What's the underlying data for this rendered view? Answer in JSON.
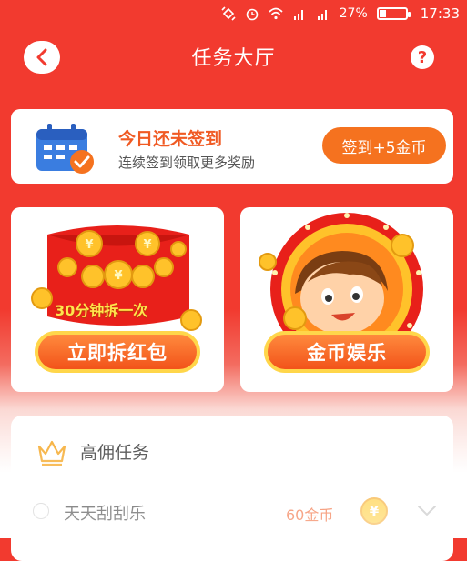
{
  "status_bar": {
    "battery": "27%",
    "time": "17:33",
    "icons": [
      "rotate-icon",
      "alarm-icon",
      "wifi-icon",
      "signal-icon",
      "signal-icon",
      "battery-icon"
    ]
  },
  "header": {
    "title": "任务大厅",
    "back_icon": "back-chevron-icon",
    "help_label": "?"
  },
  "signin": {
    "title": "今日还未签到",
    "subtitle": "连续签到领取更多奖励",
    "button": "签到+5金币",
    "icon": "calendar-icon"
  },
  "promos": [
    {
      "caption": "30分钟拆一次",
      "button": "立即拆红包",
      "icon": "red-envelope-icon"
    },
    {
      "button": "金币娱乐",
      "icon": "coin-boy-icon"
    }
  ],
  "tasks": {
    "section_title": "高佣任务",
    "section_icon": "crown-icon",
    "items": [
      {
        "name": "天天刮刮乐",
        "reward": "60金币",
        "coin_symbol": "¥"
      }
    ]
  },
  "colors": {
    "primary_red": "#f23a2f",
    "accent_orange": "#f5721f",
    "title_orange": "#f05a23",
    "gold": "#ffd64a"
  }
}
